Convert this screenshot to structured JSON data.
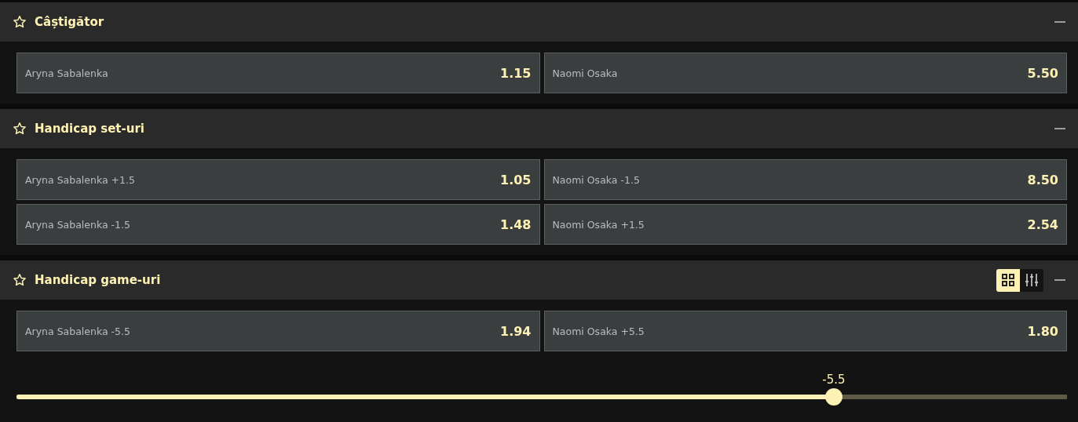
{
  "markets": [
    {
      "title": "Câștigător",
      "favorite": false,
      "expanded": true,
      "rows": [
        [
          {
            "label": "Aryna Sabalenka",
            "odds": "1.15"
          },
          {
            "label": "Naomi Osaka",
            "odds": "5.50"
          }
        ]
      ]
    },
    {
      "title": "Handicap set-uri",
      "favorite": false,
      "expanded": true,
      "rows": [
        [
          {
            "label": "Aryna Sabalenka +1.5",
            "odds": "1.05"
          },
          {
            "label": "Naomi Osaka -1.5",
            "odds": "8.50"
          }
        ],
        [
          {
            "label": "Aryna Sabalenka -1.5",
            "odds": "1.48"
          },
          {
            "label": "Naomi Osaka +1.5",
            "odds": "2.54"
          }
        ]
      ]
    },
    {
      "title": "Handicap game-uri",
      "favorite": false,
      "expanded": true,
      "view_modes": [
        {
          "kind": "grid",
          "selected": true
        },
        {
          "kind": "sliders",
          "selected": false
        }
      ],
      "rows": [
        [
          {
            "label": "Aryna Sabalenka -5.5",
            "odds": "1.94"
          },
          {
            "label": "Naomi Osaka +5.5",
            "odds": "1.80"
          }
        ]
      ],
      "slider": {
        "value": "-5.5",
        "level": 0.778
      }
    }
  ]
}
